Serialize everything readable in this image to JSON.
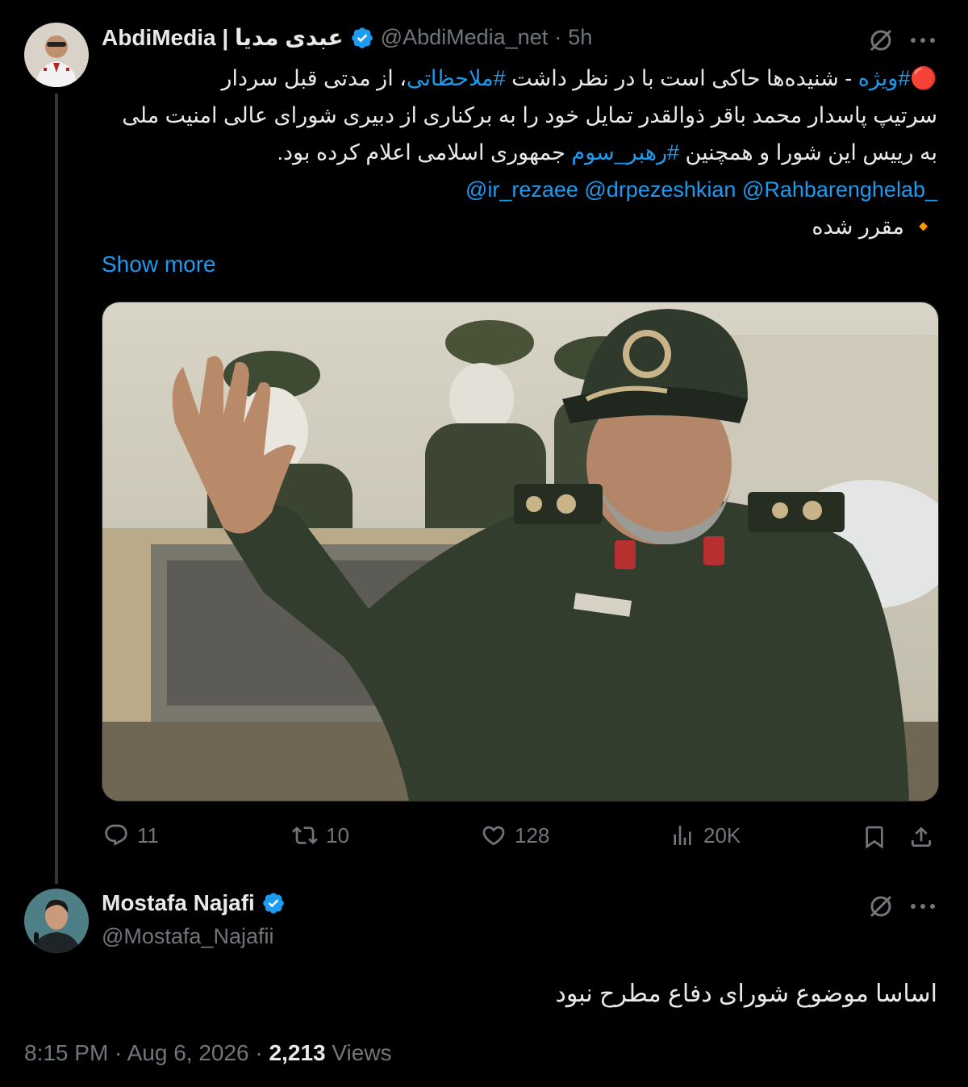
{
  "tweet1": {
    "author_name": "AbdiMedia | عبدی مدیا",
    "author_handle": "@AbdiMedia_net",
    "time_separator": "·",
    "time": "5h",
    "line1_prefix": "🔴",
    "line1_hashtag": "#ویژه",
    "line1_text": " - شنیده‌ها حاکی است با در نظر داشت ",
    "line1_hashtag2": "#ملاحظاتی",
    "line1_text2": "، از مدتی قبل سردار",
    "line2": "سرتیپ پاسدار محمد باقر ذوالقدر تمایل خود را به برکناری از دبیری شورای عالی امنیت ملی",
    "line3_text": "به رییس این شورا و همچنین ",
    "line3_hashtag": "#رهبر_سوم",
    "line3_text2": " جمهوری اسلامی اعلام کرده بود.",
    "mentions": "@ir_rezaee @drpezeshkian @Rahbarenghelab_",
    "line5": "🔸 مقرر شده",
    "show_more": "Show more",
    "image_alt": "Uniformed officer waving",
    "actions": {
      "replies": "11",
      "retweets": "10",
      "likes": "128",
      "views": "20K"
    }
  },
  "tweet2": {
    "author_name": "Mostafa Najafi",
    "author_handle": "@Mostafa_Najafii",
    "text": "اساسا موضوع شورای دفاع مطرح نبود",
    "timestamp": "8:15 PM · Aug 6, 2026 · ",
    "views_count": "2,213",
    "views_label": " Views"
  },
  "colors": {
    "background": "#000000",
    "text": "#e7e9ea",
    "secondary": "#71767b",
    "accent": "#1d9bf0"
  }
}
